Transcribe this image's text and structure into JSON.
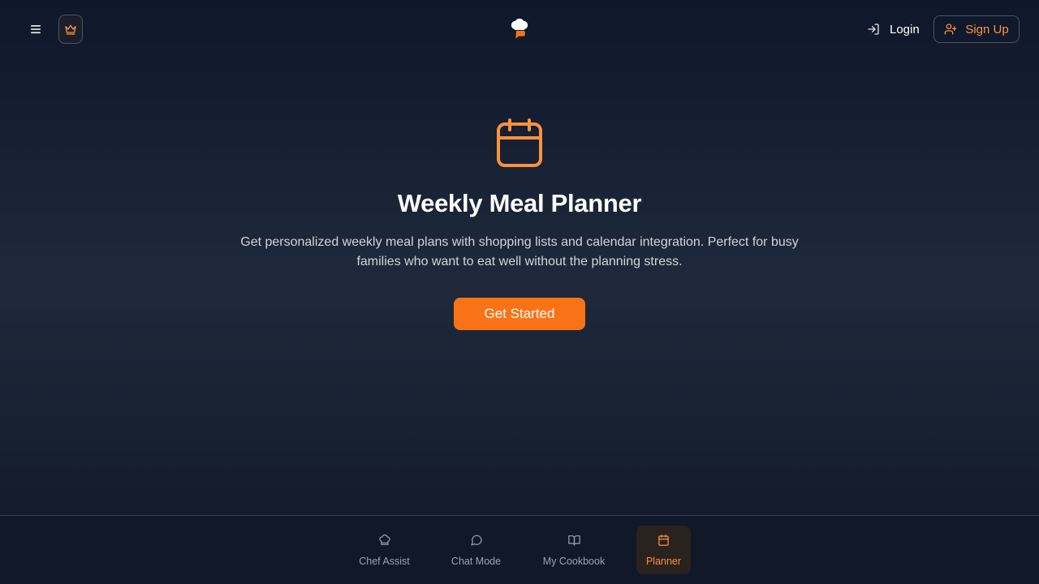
{
  "header": {
    "menu_icon": "hamburger-menu-icon",
    "premium_icon": "crown-icon",
    "logo_icon": "chef-hat-chat-icon",
    "login_label": "Login",
    "login_icon": "log-in-icon",
    "signup_label": "Sign Up",
    "signup_icon": "user-plus-icon"
  },
  "hero": {
    "icon": "calendar-icon",
    "title": "Weekly Meal Planner",
    "description": "Get personalized weekly meal plans with shopping lists and calendar integration. Perfect for busy families who want to eat well without the planning stress.",
    "cta_label": "Get Started"
  },
  "bottom_nav": {
    "items": [
      {
        "label": "Chef Assist",
        "icon": "chef-hat-icon",
        "active": false
      },
      {
        "label": "Chat Mode",
        "icon": "message-circle-icon",
        "active": false
      },
      {
        "label": "My Cookbook",
        "icon": "book-open-icon",
        "active": false
      },
      {
        "label": "Planner",
        "icon": "calendar-icon",
        "active": true
      }
    ]
  },
  "colors": {
    "accent": "#f97316",
    "accent_text": "#fb923c",
    "background_top": "#0f172a",
    "background_mid": "#1e293b",
    "muted_text": "#9ca3af",
    "body_text": "#d1d5db"
  }
}
